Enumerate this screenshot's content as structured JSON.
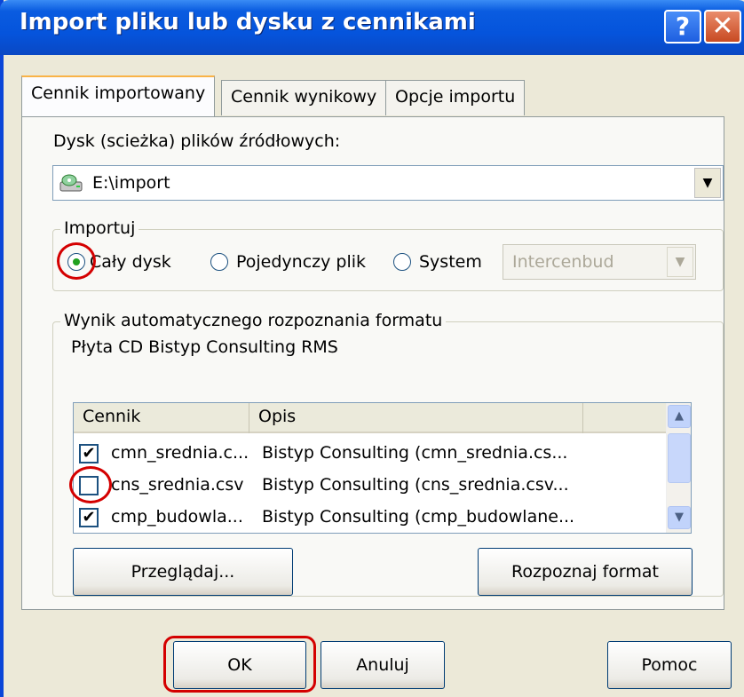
{
  "window": {
    "title": "Import pliku lub dysku z cennikami",
    "help_icon": "help-icon",
    "close_icon": "close-icon",
    "help_label": "?",
    "close_label": "✕"
  },
  "tabs": [
    {
      "label": "Cennik importowany",
      "active": true
    },
    {
      "label": "Cennik wynikowy",
      "active": false
    },
    {
      "label": "Opcje importu",
      "active": false
    }
  ],
  "source": {
    "label": "Dysk (scieżka) plików źródłowych:",
    "value": "E:\\import",
    "icon": "disk-drive-icon"
  },
  "import_group": {
    "title": "Importuj",
    "options": [
      {
        "label": "Cały dysk",
        "checked": true
      },
      {
        "label": "Pojedynczy plik",
        "checked": false
      },
      {
        "label": "System",
        "checked": false
      }
    ],
    "system_value": "Intercenbud"
  },
  "format_group": {
    "title": "Wynik automatycznego rozpoznania formatu",
    "result": "Płyta CD Bistyp Consulting RMS"
  },
  "list": {
    "columns": [
      "Cennik",
      "Opis"
    ],
    "rows": [
      {
        "checked": true,
        "cennik": "cmn_srednia.c...",
        "opis": "Bistyp Consulting (cmn_srednia.cs..."
      },
      {
        "checked": false,
        "cennik": "cns_srednia.csv",
        "opis": "Bistyp Consulting (cns_srednia.csv..."
      },
      {
        "checked": true,
        "cennik": "cmp_budowla...",
        "opis": "Bistyp Consulting (cmp_budowlane..."
      }
    ]
  },
  "buttons": {
    "browse": "Przeglądaj...",
    "recognize": "Rozpoznaj format",
    "ok": "OK",
    "cancel": "Anuluj",
    "help": "Pomoc"
  },
  "colors": {
    "titlebar": "#0554dc",
    "highlight": "#d40000",
    "dialog_bg": "#ece9d8"
  }
}
